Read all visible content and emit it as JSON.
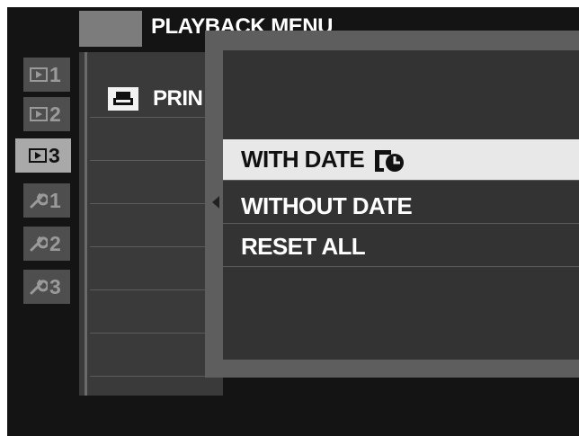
{
  "menu": {
    "title": "PLAYBACK MENU"
  },
  "tabs": [
    {
      "number": "1",
      "icon": "playback-icon"
    },
    {
      "number": "2",
      "icon": "playback-icon"
    },
    {
      "number": "3",
      "icon": "playback-icon",
      "active": true
    },
    {
      "number": "1",
      "icon": "wrench-icon"
    },
    {
      "number": "2",
      "icon": "wrench-icon"
    },
    {
      "number": "3",
      "icon": "wrench-icon"
    }
  ],
  "list": {
    "item_label": "PRIN",
    "item_icon": "print-icon"
  },
  "popup": {
    "options": [
      {
        "label": "WITH DATE",
        "icon": "date-stamp-icon",
        "selected": true
      },
      {
        "label": "WITHOUT DATE"
      },
      {
        "label": "RESET ALL"
      }
    ]
  }
}
